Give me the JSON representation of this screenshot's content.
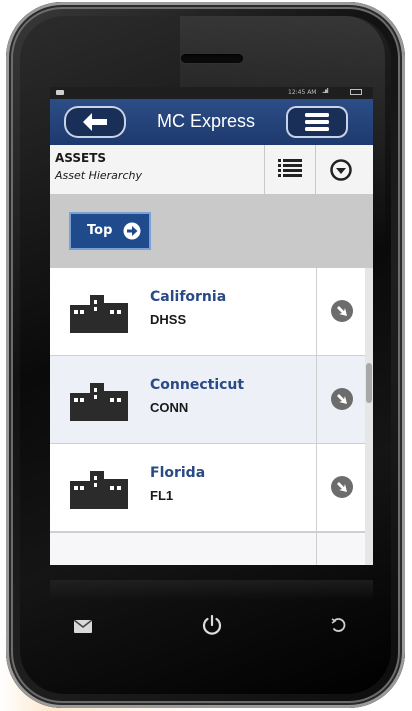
{
  "status_bar": {
    "time": "12:45 AM",
    "signal": "..ııl"
  },
  "header": {
    "title": "MC Express"
  },
  "assets": {
    "title": "ASSETS",
    "subtitle": "Asset Hierarchy"
  },
  "top_button": {
    "label": "Top"
  },
  "items": [
    {
      "name": "California",
      "code": "DHSS"
    },
    {
      "name": "Connecticut",
      "code": "CONN"
    },
    {
      "name": "Florida",
      "code": "FL1"
    }
  ],
  "icons": {
    "back": "arrow-left-icon",
    "menu": "hamburger-menu-icon",
    "list_view": "list-view-icon",
    "dropdown": "chevron-down-circle-icon",
    "top": "arrow-right-icon",
    "building": "building-icon",
    "drill": "arrow-down-right-circle-icon",
    "mail": "mail-icon",
    "power": "power-icon",
    "refresh": "refresh-icon"
  },
  "colors": {
    "header": "#1d3a6e",
    "accent": "#2a4a86",
    "top_button": "#1f4a8c",
    "row_alt": "#eef0f7"
  }
}
